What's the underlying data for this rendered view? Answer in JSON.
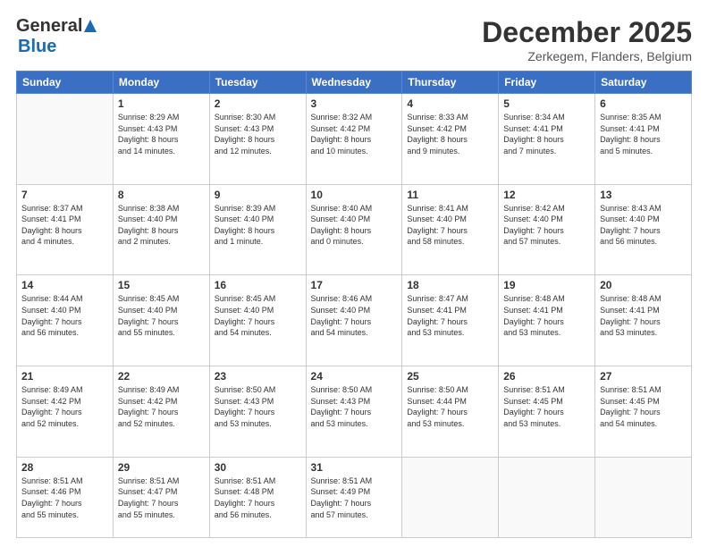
{
  "header": {
    "logo_general": "General",
    "logo_blue": "Blue",
    "month_title": "December 2025",
    "location": "Zerkegem, Flanders, Belgium"
  },
  "days_of_week": [
    "Sunday",
    "Monday",
    "Tuesday",
    "Wednesday",
    "Thursday",
    "Friday",
    "Saturday"
  ],
  "weeks": [
    [
      {
        "day": "",
        "info": ""
      },
      {
        "day": "1",
        "info": "Sunrise: 8:29 AM\nSunset: 4:43 PM\nDaylight: 8 hours\nand 14 minutes."
      },
      {
        "day": "2",
        "info": "Sunrise: 8:30 AM\nSunset: 4:43 PM\nDaylight: 8 hours\nand 12 minutes."
      },
      {
        "day": "3",
        "info": "Sunrise: 8:32 AM\nSunset: 4:42 PM\nDaylight: 8 hours\nand 10 minutes."
      },
      {
        "day": "4",
        "info": "Sunrise: 8:33 AM\nSunset: 4:42 PM\nDaylight: 8 hours\nand 9 minutes."
      },
      {
        "day": "5",
        "info": "Sunrise: 8:34 AM\nSunset: 4:41 PM\nDaylight: 8 hours\nand 7 minutes."
      },
      {
        "day": "6",
        "info": "Sunrise: 8:35 AM\nSunset: 4:41 PM\nDaylight: 8 hours\nand 5 minutes."
      }
    ],
    [
      {
        "day": "7",
        "info": "Sunrise: 8:37 AM\nSunset: 4:41 PM\nDaylight: 8 hours\nand 4 minutes."
      },
      {
        "day": "8",
        "info": "Sunrise: 8:38 AM\nSunset: 4:40 PM\nDaylight: 8 hours\nand 2 minutes."
      },
      {
        "day": "9",
        "info": "Sunrise: 8:39 AM\nSunset: 4:40 PM\nDaylight: 8 hours\nand 1 minute."
      },
      {
        "day": "10",
        "info": "Sunrise: 8:40 AM\nSunset: 4:40 PM\nDaylight: 8 hours\nand 0 minutes."
      },
      {
        "day": "11",
        "info": "Sunrise: 8:41 AM\nSunset: 4:40 PM\nDaylight: 7 hours\nand 58 minutes."
      },
      {
        "day": "12",
        "info": "Sunrise: 8:42 AM\nSunset: 4:40 PM\nDaylight: 7 hours\nand 57 minutes."
      },
      {
        "day": "13",
        "info": "Sunrise: 8:43 AM\nSunset: 4:40 PM\nDaylight: 7 hours\nand 56 minutes."
      }
    ],
    [
      {
        "day": "14",
        "info": "Sunrise: 8:44 AM\nSunset: 4:40 PM\nDaylight: 7 hours\nand 56 minutes."
      },
      {
        "day": "15",
        "info": "Sunrise: 8:45 AM\nSunset: 4:40 PM\nDaylight: 7 hours\nand 55 minutes."
      },
      {
        "day": "16",
        "info": "Sunrise: 8:45 AM\nSunset: 4:40 PM\nDaylight: 7 hours\nand 54 minutes."
      },
      {
        "day": "17",
        "info": "Sunrise: 8:46 AM\nSunset: 4:40 PM\nDaylight: 7 hours\nand 54 minutes."
      },
      {
        "day": "18",
        "info": "Sunrise: 8:47 AM\nSunset: 4:41 PM\nDaylight: 7 hours\nand 53 minutes."
      },
      {
        "day": "19",
        "info": "Sunrise: 8:48 AM\nSunset: 4:41 PM\nDaylight: 7 hours\nand 53 minutes."
      },
      {
        "day": "20",
        "info": "Sunrise: 8:48 AM\nSunset: 4:41 PM\nDaylight: 7 hours\nand 53 minutes."
      }
    ],
    [
      {
        "day": "21",
        "info": "Sunrise: 8:49 AM\nSunset: 4:42 PM\nDaylight: 7 hours\nand 52 minutes."
      },
      {
        "day": "22",
        "info": "Sunrise: 8:49 AM\nSunset: 4:42 PM\nDaylight: 7 hours\nand 52 minutes."
      },
      {
        "day": "23",
        "info": "Sunrise: 8:50 AM\nSunset: 4:43 PM\nDaylight: 7 hours\nand 53 minutes."
      },
      {
        "day": "24",
        "info": "Sunrise: 8:50 AM\nSunset: 4:43 PM\nDaylight: 7 hours\nand 53 minutes."
      },
      {
        "day": "25",
        "info": "Sunrise: 8:50 AM\nSunset: 4:44 PM\nDaylight: 7 hours\nand 53 minutes."
      },
      {
        "day": "26",
        "info": "Sunrise: 8:51 AM\nSunset: 4:45 PM\nDaylight: 7 hours\nand 53 minutes."
      },
      {
        "day": "27",
        "info": "Sunrise: 8:51 AM\nSunset: 4:45 PM\nDaylight: 7 hours\nand 54 minutes."
      }
    ],
    [
      {
        "day": "28",
        "info": "Sunrise: 8:51 AM\nSunset: 4:46 PM\nDaylight: 7 hours\nand 55 minutes."
      },
      {
        "day": "29",
        "info": "Sunrise: 8:51 AM\nSunset: 4:47 PM\nDaylight: 7 hours\nand 55 minutes."
      },
      {
        "day": "30",
        "info": "Sunrise: 8:51 AM\nSunset: 4:48 PM\nDaylight: 7 hours\nand 56 minutes."
      },
      {
        "day": "31",
        "info": "Sunrise: 8:51 AM\nSunset: 4:49 PM\nDaylight: 7 hours\nand 57 minutes."
      },
      {
        "day": "",
        "info": ""
      },
      {
        "day": "",
        "info": ""
      },
      {
        "day": "",
        "info": ""
      }
    ]
  ]
}
